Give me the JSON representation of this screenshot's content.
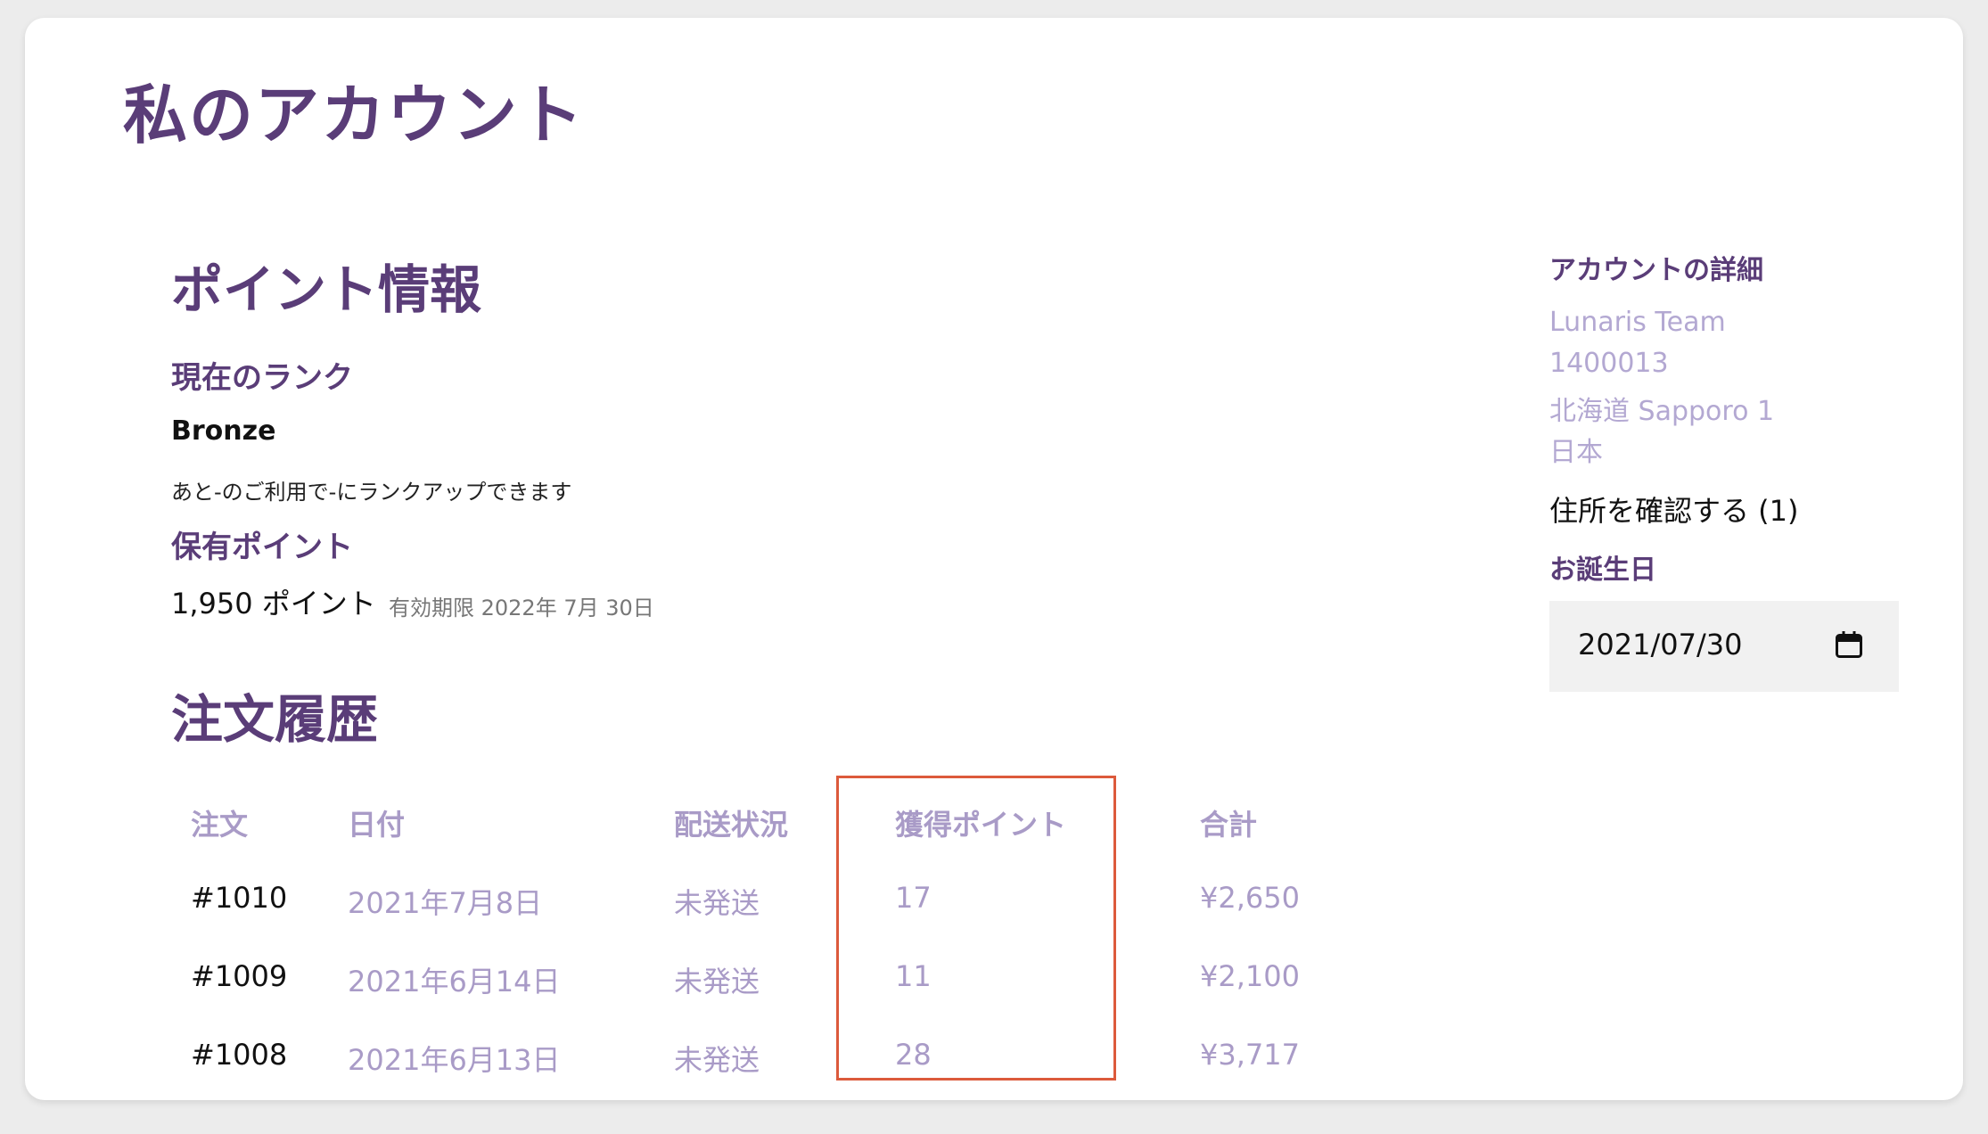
{
  "header": {
    "title": "私のアカウント"
  },
  "points": {
    "section_title": "ポイント情報",
    "rank_label": "現在のランク",
    "rank_name": "Bronze",
    "rank_note": "あと-のご利用で-にランクアップできます",
    "held_label": "保有ポイント",
    "held_value": "1,950 ポイント",
    "expiry": "有効期限 2022年 7月 30日"
  },
  "orders": {
    "section_title": "注文履歴",
    "columns": [
      "注文",
      "日付",
      "配送状況",
      "獲得ポイント",
      "合計"
    ],
    "rows": [
      {
        "order": "#1010",
        "date": "2021年7月8日",
        "status": "未発送",
        "points": "17",
        "total": "¥2,650"
      },
      {
        "order": "#1009",
        "date": "2021年6月14日",
        "status": "未発送",
        "points": "11",
        "total": "¥2,100"
      },
      {
        "order": "#1008",
        "date": "2021年6月13日",
        "status": "未発送",
        "points": "28",
        "total": "¥3,717"
      }
    ]
  },
  "account": {
    "title": "アカウントの詳細",
    "address_lines": [
      "Lunaris Team",
      "1400013",
      "北海道 Sapporo 1",
      "日本"
    ],
    "address_link": "住所を確認する (1)",
    "birthday_label": "お誕生日",
    "birthday_value": "2021/07/30"
  },
  "colors": {
    "heading": "#5a3d78",
    "muted": "#a99bc7",
    "highlight": "#dc5a3c"
  },
  "icons": {
    "date_picker": "calendar-icon"
  }
}
